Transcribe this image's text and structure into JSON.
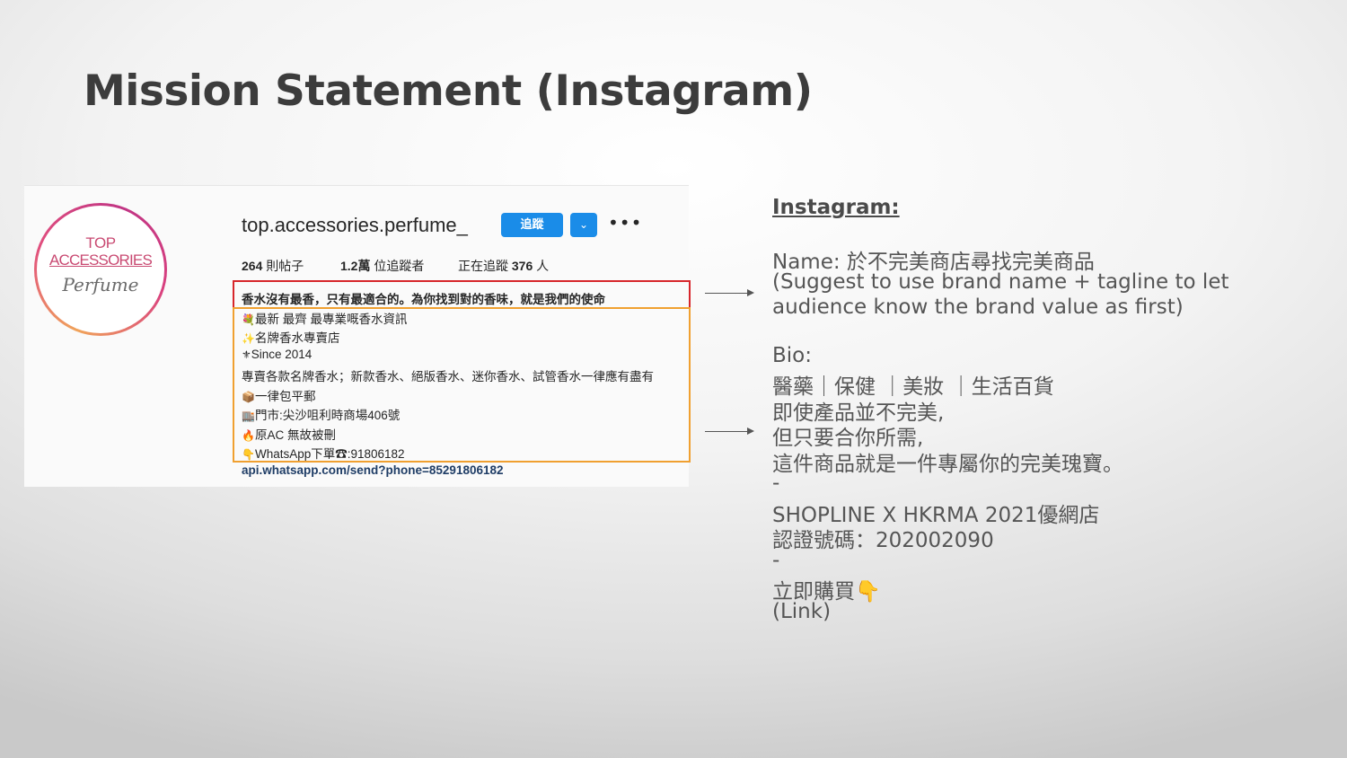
{
  "slide": {
    "title": "Mission Statement (Instagram)"
  },
  "instagram": {
    "logo": {
      "line1": "TOP",
      "line2": "ACCESSORIES",
      "script": "Perfume"
    },
    "username": "top.accessories.perfume_",
    "follow_label": "追蹤",
    "dropdown_glyph": "⌄",
    "more_glyph": "•••",
    "stats": [
      {
        "value": "264",
        "label": " 則帖子"
      },
      {
        "value": "1.2萬",
        "label": " 位追蹤者"
      },
      {
        "prefix": "正在追蹤 ",
        "value": "376",
        "label": " 人"
      }
    ],
    "name_line": "香水沒有最香，只有最適合的。為你找到對的香味，就是我們的使命",
    "bio_lines": [
      {
        "emoji": "💐",
        "text": "最新 最齊 最專業嘅香水資訊"
      },
      {
        "emoji": "✨",
        "text": "名牌香水專賣店"
      },
      {
        "emoji": "⚜",
        "text": "Since 2014"
      },
      {
        "emoji": "",
        "text": "專賣各款名牌香水；新款香水、絕版香水、迷你香水、試管香水一律應有盡有"
      },
      {
        "emoji": "📦",
        "text": "一律包平郵"
      },
      {
        "emoji": "🏬",
        "text": "門市:尖沙咀利時商場406號"
      },
      {
        "emoji": "🔥",
        "text": "原AC 無故被刪"
      },
      {
        "emoji": "👇",
        "text": "WhatsApp下單☎:91806182"
      }
    ],
    "link": "api.whatsapp.com/send?phone=85291806182"
  },
  "notes": {
    "heading": "Instagram:",
    "name_label": "Name: 於不完美商店尋找完美商品",
    "name_suggest_1": " (Suggest to use brand name + tagline to let",
    "name_suggest_2": "audience know the brand value as first)",
    "bio_label": "Bio:",
    "bio_lines": [
      "醫藥｜保健 ｜美妝 ｜生活百貨",
      "即使產品並不完美,",
      "但只要合你所需,",
      "這件商品就是一件專屬你的完美瑰寶。",
      "-",
      "SHOPLINE X HKRMA 2021優網店",
      "認證號碼：202002090",
      "-",
      "立即購買👇",
      "(Link)"
    ]
  }
}
